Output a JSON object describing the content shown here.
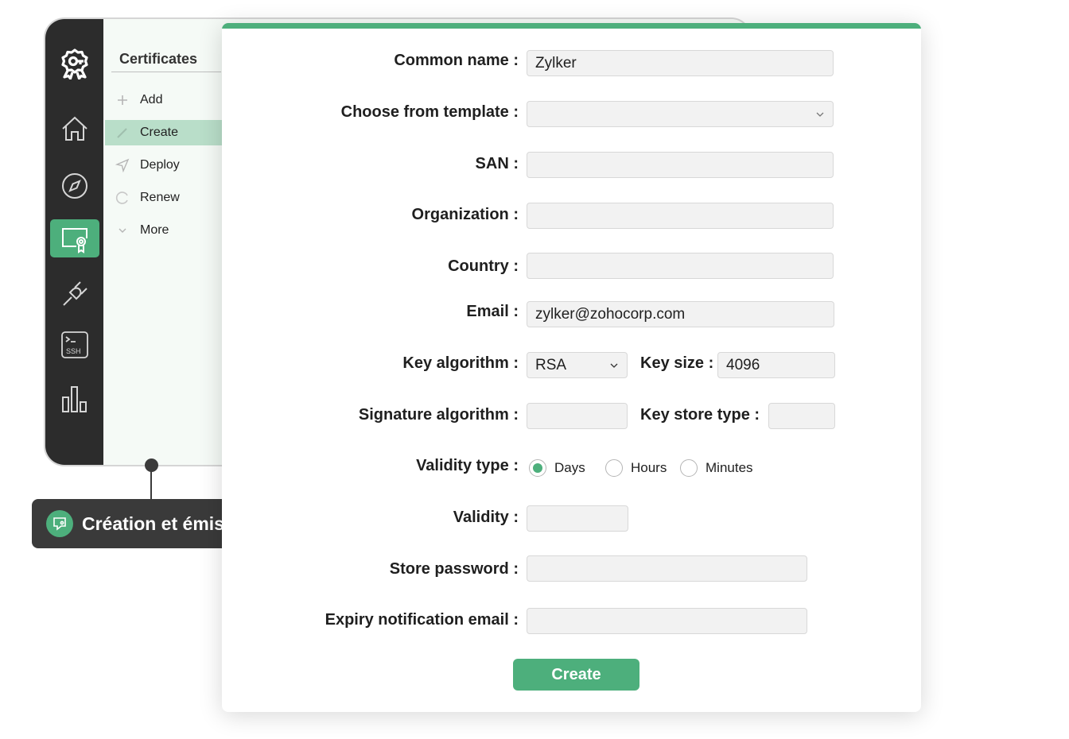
{
  "sidebar": {
    "icons": [
      "logo-key-badge-icon",
      "home-icon",
      "compass-icon",
      "certificate-icon",
      "plug-icon",
      "ssh-terminal-icon",
      "bar-chart-icon"
    ],
    "ssh_label": "SSH"
  },
  "subnav": {
    "title": "Certificates",
    "items": [
      {
        "label": "Add",
        "icon": "plus-icon"
      },
      {
        "label": "Create",
        "icon": "pencil-icon",
        "active": true
      },
      {
        "label": "Deploy",
        "icon": "send-icon"
      },
      {
        "label": "Renew",
        "icon": "refresh-icon"
      },
      {
        "label": "More",
        "icon": "chevron-down-icon"
      }
    ]
  },
  "callout": {
    "text": "Création et émission simplifiées"
  },
  "form": {
    "common_name": {
      "label": "Common name :",
      "value": "Zylker"
    },
    "template": {
      "label": "Choose from template :",
      "value": ""
    },
    "san": {
      "label": "SAN :",
      "value": ""
    },
    "organization": {
      "label": "Organization :",
      "value": ""
    },
    "country": {
      "label": "Country :",
      "value": ""
    },
    "email": {
      "label": "Email :",
      "value": "zylker@zohocorp.com"
    },
    "key_algorithm": {
      "label": "Key algorithm :",
      "value": "RSA"
    },
    "key_size": {
      "label": "Key size :",
      "value": "4096"
    },
    "signature_algorithm": {
      "label": "Signature algorithm :",
      "value": ""
    },
    "key_store_type": {
      "label": "Key store type :",
      "value": ""
    },
    "validity_type": {
      "label": "Validity type :",
      "options": [
        "Days",
        "Hours",
        "Minutes"
      ],
      "selected": "Days"
    },
    "validity": {
      "label": "Validity :",
      "value": ""
    },
    "store_password": {
      "label": "Store password :",
      "value": ""
    },
    "expiry_email": {
      "label": "Expiry notification email :",
      "value": ""
    },
    "submit_label": "Create"
  },
  "colors": {
    "accent": "#4daf7c",
    "rail": "#2c2c2c",
    "callout_bg": "#3a3a3a"
  }
}
